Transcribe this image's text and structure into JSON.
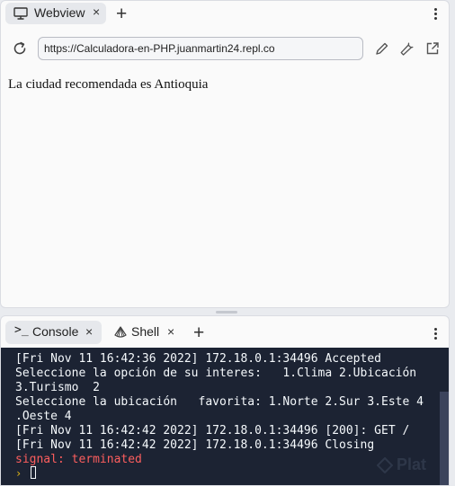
{
  "webview": {
    "tab_label": "Webview",
    "tab_close": "×",
    "new_tab": "+",
    "url": "https://Calculadora-en-PHP.juanmartin24.repl.co",
    "content_text": "La ciudad recomendada es Antioquia"
  },
  "console_panel": {
    "tabs": [
      {
        "label": "Console",
        "close": "×",
        "active": true
      },
      {
        "label": "Shell",
        "close": "×",
        "active": false
      }
    ],
    "new_tab": "+",
    "lines": [
      "[Fri Nov 11 16:42:36 2022] 172.18.0.1:34496 Accepted",
      "Seleccione la opción de su interes:   1.Clima 2.Ubicación",
      "3.Turismo  2",
      "Seleccione la ubicación   favorita: 1.Norte 2.Sur 3.Este 4",
      ".Oeste 4",
      "[Fri Nov 11 16:42:42 2022] 172.18.0.1:34496 [200]: GET /",
      "[Fri Nov 11 16:42:42 2022] 172.18.0.1:34496 Closing"
    ],
    "signal_line": "signal: terminated",
    "prompt_symbol": "›",
    "watermark": "Plat"
  },
  "colors": {
    "terminal_bg": "#1c2333",
    "terminal_text": "#f5f9fc",
    "signal_red": "#fd5e5e",
    "prompt_yellow": "#e2b714"
  }
}
